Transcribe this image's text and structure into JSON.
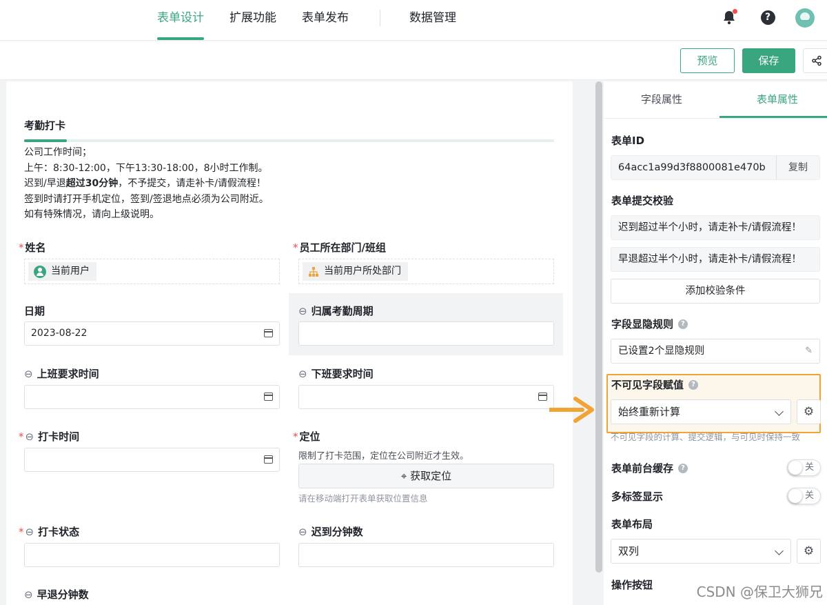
{
  "header": {
    "nav": [
      "表单设计",
      "扩展功能",
      "表单发布",
      "数据管理"
    ],
    "active_nav": "表单设计",
    "accent": "#3aa67f"
  },
  "toolbar": {
    "preview_label": "预览",
    "save_label": "保存"
  },
  "form": {
    "section_title": "考勤打卡",
    "description": {
      "line1": "公司工作时间；",
      "line2": "上午：8:30-12:00，下午13:30-18:00，8小时工作制。",
      "line3_pre": "迟到/早退",
      "line3_bold": "超过30分钟",
      "line3_post": "，不予提交，请走补卡/请假流程！",
      "line4": "签到时请打开手机定位，签到/签退地点必须为公司附近。",
      "line5": "如有特殊情况，请向上级说明。"
    },
    "fields": {
      "name": {
        "label": "姓名",
        "chip": "当前用户"
      },
      "dept": {
        "label": "员工所在部门/班组",
        "chip": "当前用户所处部门"
      },
      "date": {
        "label": "日期",
        "value": "2023-08-22"
      },
      "period": {
        "label": "归属考勤周期"
      },
      "work_start": {
        "label": "上班要求时间"
      },
      "work_end": {
        "label": "下班要求时间"
      },
      "punch_time": {
        "label": "打卡时间"
      },
      "location": {
        "label": "定位",
        "note": "限制了打卡范围，定位在公司附近才生效。",
        "button": "获取定位",
        "hint": "请在移动端打开表单获取位置信息"
      },
      "punch_status": {
        "label": "打卡状态"
      },
      "late_minutes": {
        "label": "迟到分钟数"
      },
      "early_minutes": {
        "label": "早退分钟数"
      }
    }
  },
  "panel": {
    "tabs": [
      "字段属性",
      "表单属性"
    ],
    "active_tab": "表单属性",
    "form_id_label": "表单ID",
    "form_id": "64acc1a99d3f8800081e470b",
    "copy_label": "复制",
    "validation_label": "表单提交校验",
    "validations": [
      "迟到超过半个小时，请走补卡/请假流程！",
      "早退超过半个小时，请走补卡/请假流程！"
    ],
    "add_validation": "添加校验条件",
    "visibility_label": "字段显隐规则",
    "visibility_value": "已设置2个显隐规则",
    "invisible_label": "不可见字段赋值",
    "invisible_value": "始终重新计算",
    "invisible_hint": "不可见字段的计算、提交逻辑，与可见时保持一致",
    "cache_label": "表单前台缓存",
    "cache_toggle": "关",
    "multitab_label": "多标签显示",
    "multitab_toggle": "关",
    "layout_label": "表单布局",
    "layout_value": "双列",
    "actions_label": "操作按钮"
  },
  "highlight_color": "#f1a334",
  "watermark": "CSDN @保卫大狮兄"
}
